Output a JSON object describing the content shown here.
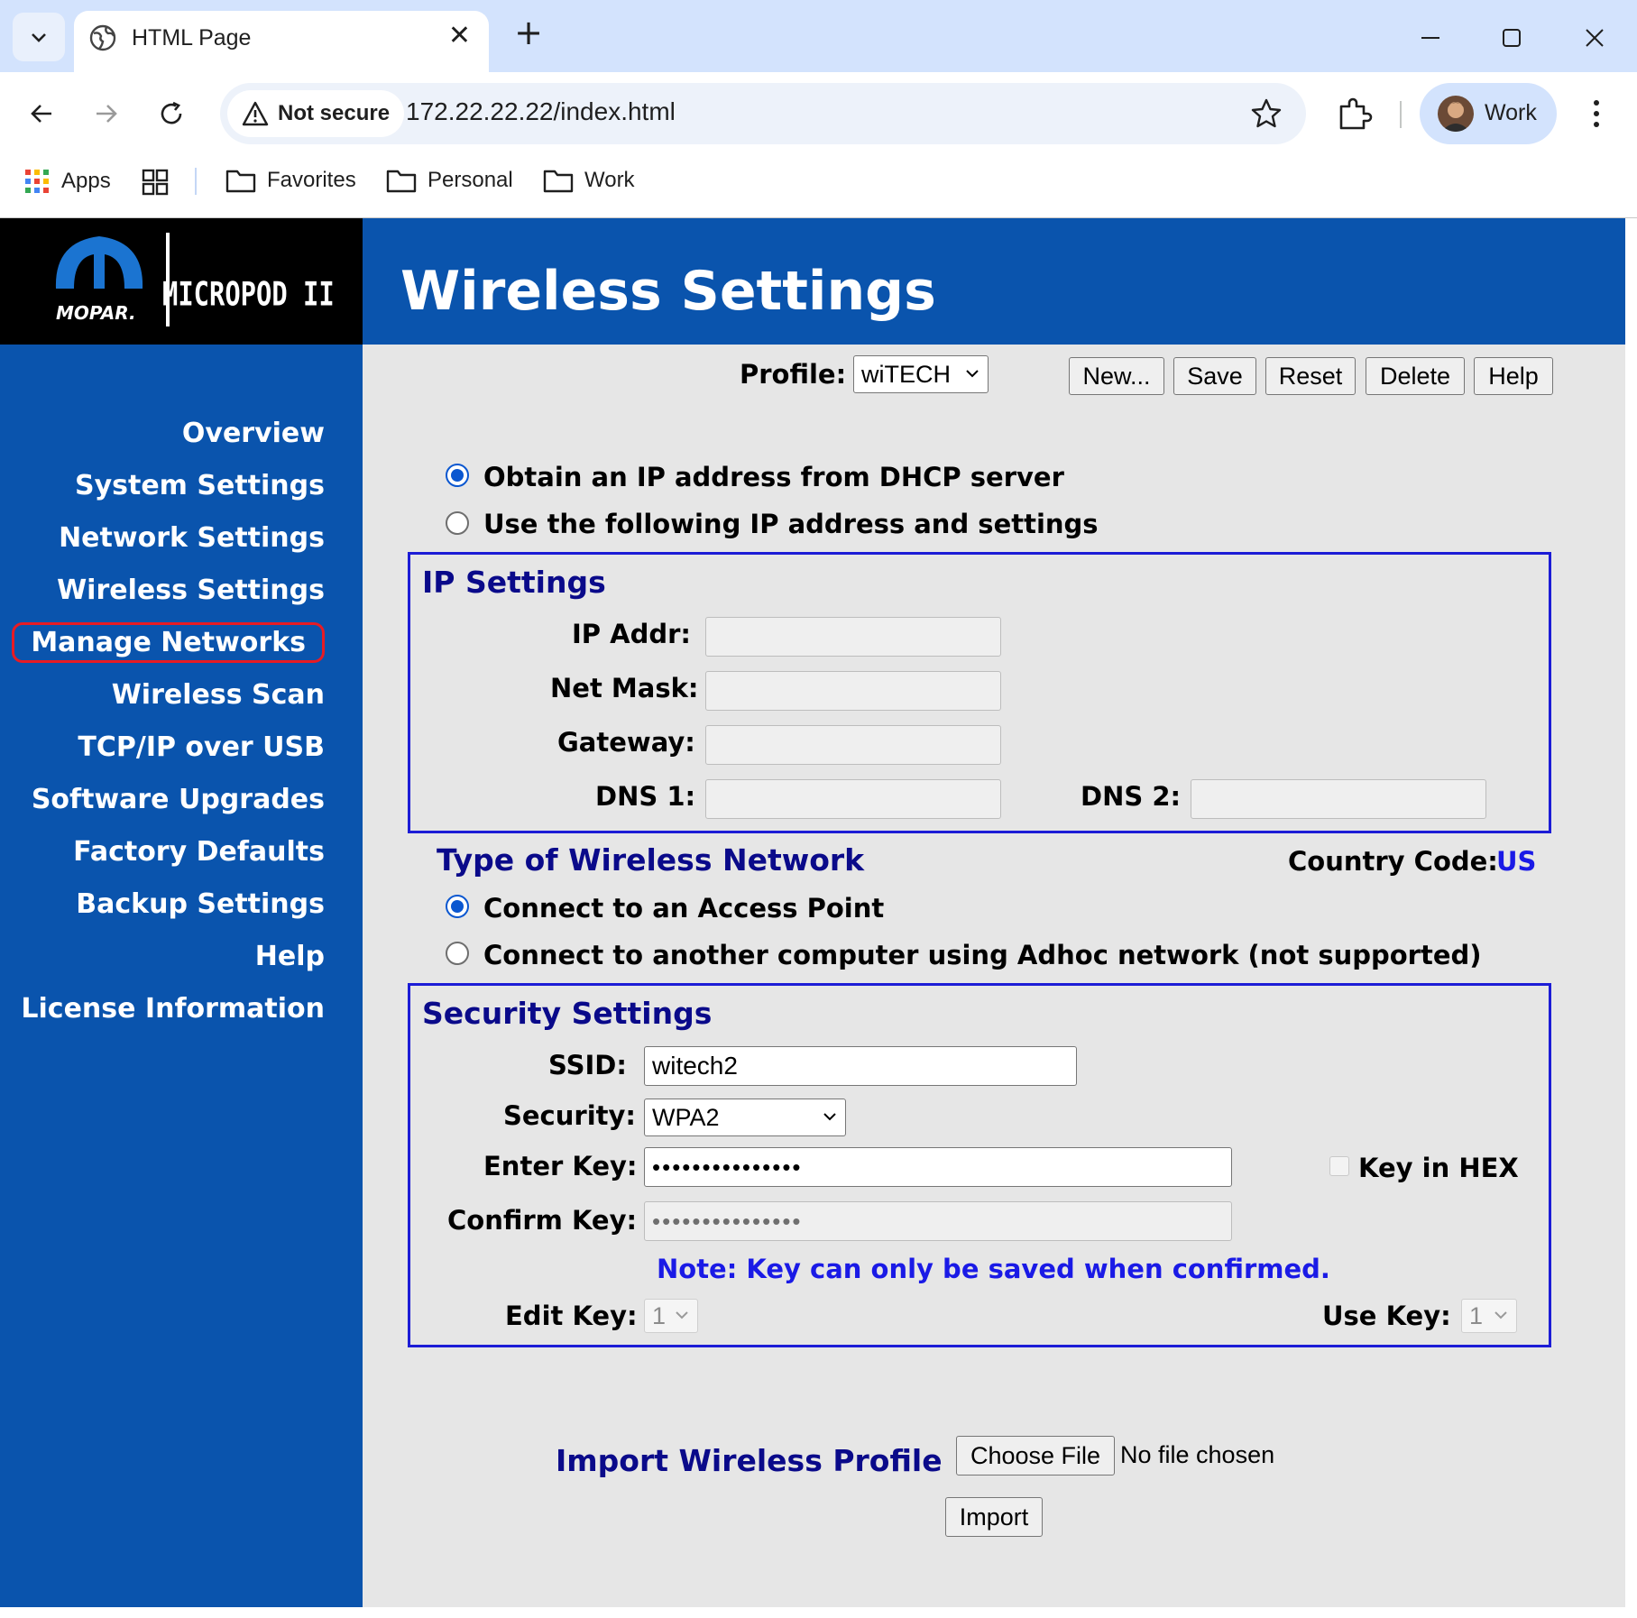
{
  "browser": {
    "tab_title": "HTML Page",
    "security_label": "Not secure",
    "url": "172.22.22.22/index.html",
    "profile_name": "Work",
    "bookmarks": [
      "Apps",
      "Favorites",
      "Personal",
      "Work"
    ]
  },
  "logo": {
    "brand": "MOPAR.",
    "product": "MICROPOD II"
  },
  "header": {
    "title": "Wireless Settings"
  },
  "sidebar": {
    "items": [
      {
        "label": "Overview"
      },
      {
        "label": "System Settings"
      },
      {
        "label": "Network Settings"
      },
      {
        "label": "Wireless Settings"
      },
      {
        "label": "Manage Networks"
      },
      {
        "label": "Wireless Scan"
      },
      {
        "label": "TCP/IP over USB"
      },
      {
        "label": "Software Upgrades"
      },
      {
        "label": "Factory Defaults"
      },
      {
        "label": "Backup Settings"
      },
      {
        "label": "Help"
      },
      {
        "label": "License Information"
      }
    ]
  },
  "profile": {
    "label": "Profile:",
    "selected": "wiTECH",
    "buttons": {
      "new": "New...",
      "save": "Save",
      "reset": "Reset",
      "delete": "Delete",
      "help": "Help"
    }
  },
  "ip_mode": {
    "dhcp_label": "Obtain an IP address from DHCP server",
    "static_label": "Use the following IP address and settings",
    "selected": "dhcp"
  },
  "ip_settings": {
    "title": "IP Settings",
    "ip_label": "IP Addr:",
    "mask_label": "Net Mask:",
    "gateway_label": "Gateway:",
    "dns1_label": "DNS 1:",
    "dns2_label": "DNS 2:",
    "ip_value": "",
    "mask_value": "",
    "gateway_value": "",
    "dns1_value": "",
    "dns2_value": ""
  },
  "network_type": {
    "title": "Type of Wireless Network",
    "country_label": "Country Code:",
    "country_value": "US",
    "ap_label": "Connect to an Access Point",
    "adhoc_label": "Connect to another computer using Adhoc network (not supported)",
    "selected": "ap"
  },
  "security": {
    "title": "Security Settings",
    "ssid_label": "SSID:",
    "ssid_value": "witech2",
    "security_label": "Security:",
    "security_value": "WPA2",
    "key_label": "Enter Key:",
    "key_value": "•••••••••••••••",
    "confirm_label": "Confirm Key:",
    "confirm_value": "•••••••••••••••",
    "hex_label": "Key in HEX",
    "hex_checked": false,
    "note": "Note: Key can only be saved when confirmed.",
    "edit_key_label": "Edit Key:",
    "edit_key_value": "1",
    "use_key_label": "Use Key:",
    "use_key_value": "1"
  },
  "import": {
    "title": "Import Wireless Profile",
    "choose_label": "Choose File",
    "file_status": "No file chosen",
    "import_label": "Import"
  },
  "colors": {
    "brand_blue": "#0a54ad",
    "section_title": "#0a0a8a",
    "box_border": "#1c1cd6",
    "note": "#1a1ae6",
    "highlight": "#e81b24"
  }
}
